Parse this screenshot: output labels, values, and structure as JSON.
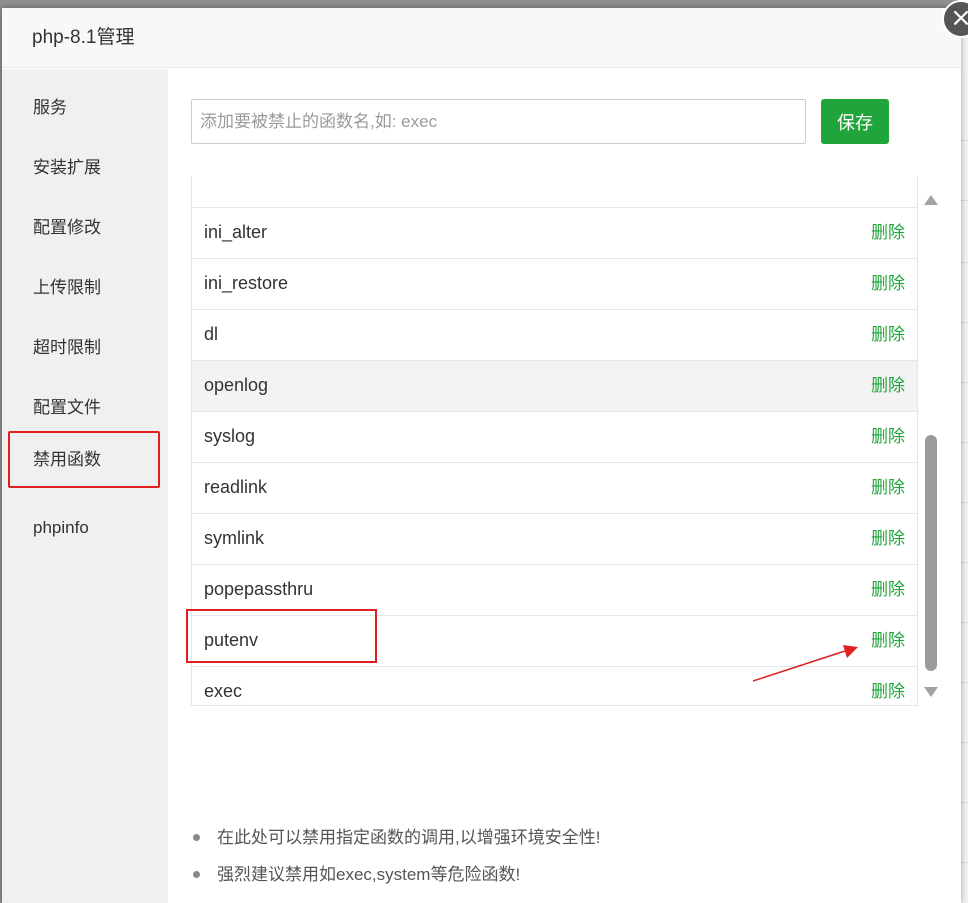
{
  "dialog": {
    "title": "php-8.1管理",
    "close_symbol": "×"
  },
  "sidebar": {
    "items": [
      {
        "label": "服务"
      },
      {
        "label": "安装扩展"
      },
      {
        "label": "配置修改"
      },
      {
        "label": "上传限制"
      },
      {
        "label": "超时限制"
      },
      {
        "label": "配置文件"
      },
      {
        "label": "禁用函数",
        "active": true
      },
      {
        "label": "phpinfo"
      }
    ]
  },
  "form": {
    "input_placeholder": "添加要被禁止的函数名,如: exec",
    "input_value": "",
    "save_label": "保存"
  },
  "functions": {
    "delete_label": "删除",
    "rows": [
      {
        "name": "ini_alter"
      },
      {
        "name": "ini_restore"
      },
      {
        "name": "dl"
      },
      {
        "name": "openlog",
        "hover": true
      },
      {
        "name": "syslog"
      },
      {
        "name": "readlink"
      },
      {
        "name": "symlink"
      },
      {
        "name": "popepassthru"
      },
      {
        "name": "putenv",
        "annotated": true
      },
      {
        "name": "exec"
      }
    ]
  },
  "tips": [
    "在此处可以禁用指定函数的调用,以增强环境安全性!",
    "强烈建议禁用如exec,system等危险函数!"
  ],
  "colors": {
    "accent_green": "#20a53a",
    "annotation_red": "#e02020"
  }
}
